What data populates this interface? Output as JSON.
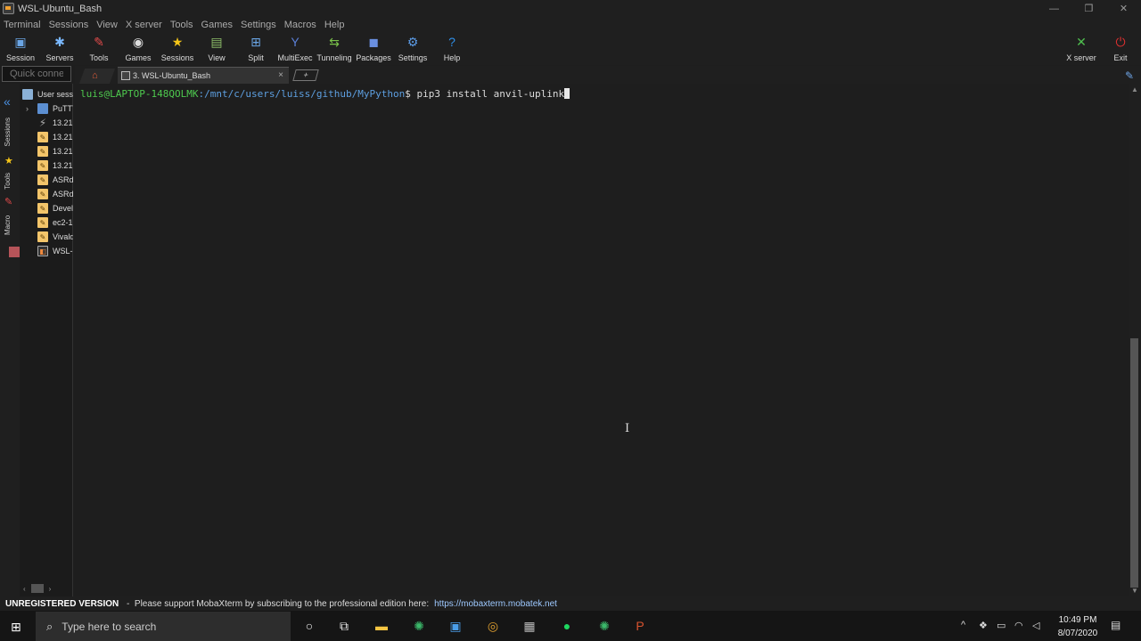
{
  "window": {
    "title": "WSL-Ubuntu_Bash"
  },
  "menu": [
    "Terminal",
    "Sessions",
    "View",
    "X server",
    "Tools",
    "Games",
    "Settings",
    "Macros",
    "Help"
  ],
  "toolbar": {
    "items": [
      {
        "label": "Session",
        "icon": "session-icon",
        "glyph": "▣",
        "color": "#6aa5e5"
      },
      {
        "label": "Servers",
        "icon": "servers-icon",
        "glyph": "✱",
        "color": "#7ab8ff"
      },
      {
        "label": "Tools",
        "icon": "tools-icon",
        "glyph": "✎",
        "color": "#e24b4b"
      },
      {
        "label": "Games",
        "icon": "games-icon",
        "glyph": "◉",
        "color": "#dddddd"
      },
      {
        "label": "Sessions",
        "icon": "star-icon",
        "glyph": "★",
        "color": "#f5c518"
      },
      {
        "label": "View",
        "icon": "view-icon",
        "glyph": "▤",
        "color": "#8fbf6a"
      },
      {
        "label": "Split",
        "icon": "split-icon",
        "glyph": "⊞",
        "color": "#6aa5e5"
      },
      {
        "label": "MultiExec",
        "icon": "multiexec-icon",
        "glyph": "Y",
        "color": "#5b7fd6"
      },
      {
        "label": "Tunneling",
        "icon": "tunneling-icon",
        "glyph": "⇆",
        "color": "#7ac24a"
      },
      {
        "label": "Packages",
        "icon": "packages-icon",
        "glyph": "◼",
        "color": "#6a8fe0"
      },
      {
        "label": "Settings",
        "icon": "settings-icon",
        "glyph": "⚙",
        "color": "#5b9be6"
      },
      {
        "label": "Help",
        "icon": "help-icon",
        "glyph": "?",
        "color": "#2f8fe8"
      }
    ],
    "right": [
      {
        "label": "X server",
        "icon": "x-server-icon",
        "glyph": "✕",
        "color": "#4fbf4f"
      },
      {
        "label": "Exit",
        "icon": "power-icon",
        "glyph": "⏻",
        "color": "#e03030"
      }
    ]
  },
  "quick_connect": {
    "placeholder": "Quick connect..."
  },
  "tabs": {
    "session_tab": "3. WSL-Ubuntu_Bash",
    "close": "×",
    "new": "+"
  },
  "sidebar": {
    "vtabs": [
      "Sessions",
      "Tools",
      "Macros"
    ],
    "items": [
      {
        "label": "User sessions",
        "type": "user"
      },
      {
        "label": "PuTTY sessions",
        "type": "putty"
      },
      {
        "label": "13.21",
        "type": "net"
      },
      {
        "label": "13.21",
        "type": "ssh"
      },
      {
        "label": "13.21",
        "type": "ssh"
      },
      {
        "label": "13.21",
        "type": "ssh"
      },
      {
        "label": "ASRd",
        "type": "ssh"
      },
      {
        "label": "ASRd",
        "type": "ssh"
      },
      {
        "label": "Devel",
        "type": "ssh"
      },
      {
        "label": "ec2-1",
        "type": "ssh"
      },
      {
        "label": "Vivald",
        "type": "ssh"
      },
      {
        "label": "WSL-",
        "type": "wsl"
      }
    ]
  },
  "terminal": {
    "user": "luis@LAPTOP-148QOLMK",
    "path": ":/mnt/c/users/luiss/github/MyPython",
    "prompt_char": "$ ",
    "command": "pip3 install anvil-uplink"
  },
  "status": {
    "label": "UNREGISTERED VERSION",
    "text": " -  Please support MobaXterm by subscribing to the professional edition here:",
    "link": "https://mobaxterm.mobatek.net"
  },
  "taskbar": {
    "search_placeholder": "Type here to search",
    "time": "10:49 PM",
    "date": "8/07/2020"
  }
}
